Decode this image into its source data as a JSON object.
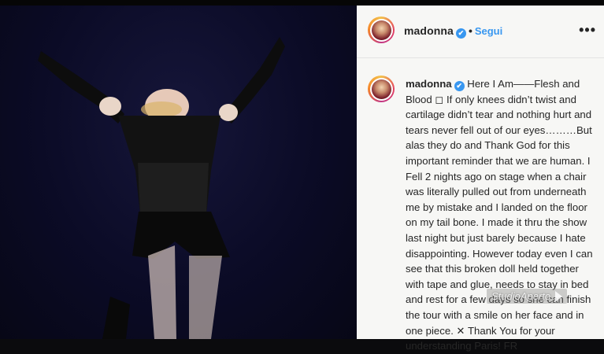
{
  "post": {
    "username": "madonna",
    "verified_mark": "✔",
    "dot": "•",
    "follow_label": "Segui",
    "more_label": "•••"
  },
  "caption": {
    "username": "madonna",
    "text": "Here I Am——Flesh and Blood ◻ If only knees didn’t twist and cartilage didn’t tear and nothing hurt and tears never fell out of our eyes………But alas they do and Thank God for this important reminder that we are human. I Fell 2 nights ago on stage when a chair was literally pulled out from underneath me by mistake and I landed on the floor on my tail bone. I made it thru the show last night but just barely because I hate disappointing. However today even I can see that this broken doll held together with tape and glue, needs to stay in bed and rest for a few days so she can finish the tour with a smile on her face and in one piece. ✕ Thank You for your understanding Paris! FR"
  },
  "watermark": {
    "label": "StudioAperto"
  },
  "colors": {
    "accent_blue": "#3897f0",
    "panel_bg": "#f7f7f5",
    "photo_bg": "#0b0b26"
  }
}
